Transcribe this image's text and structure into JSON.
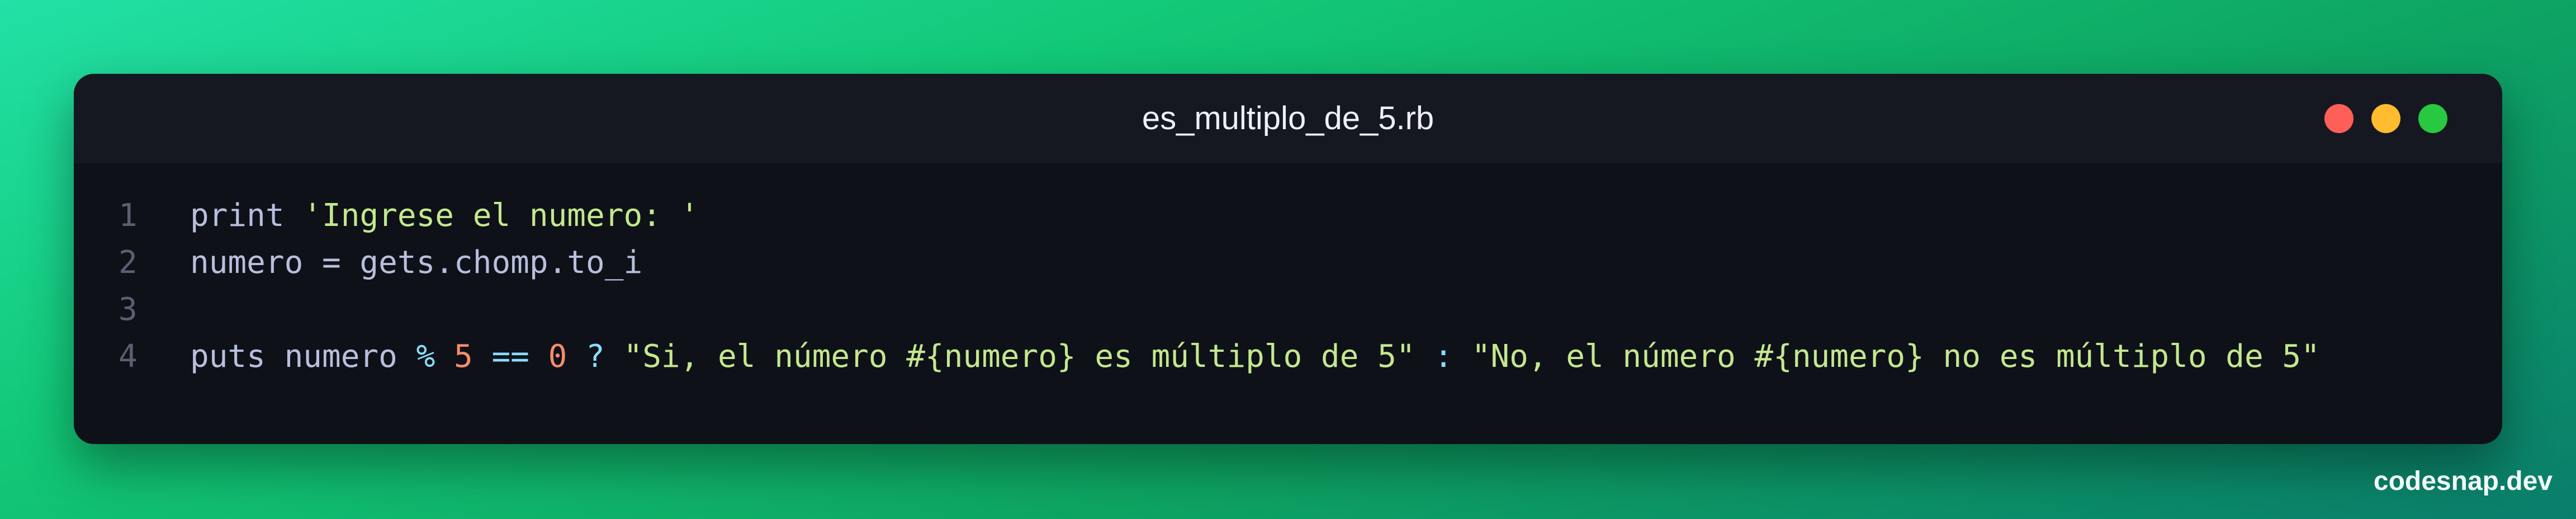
{
  "window": {
    "title": "es_multiplo_de_5.rb",
    "controls": [
      {
        "name": "close",
        "color": "#ff5f57"
      },
      {
        "name": "minimize",
        "color": "#febc2e"
      },
      {
        "name": "maximize",
        "color": "#28c840"
      }
    ]
  },
  "code": {
    "lines": [
      {
        "number": "1",
        "tokens": [
          {
            "text": "print ",
            "type": "id"
          },
          {
            "text": "'Ingrese el numero: '",
            "type": "str"
          }
        ]
      },
      {
        "number": "2",
        "tokens": [
          {
            "text": "numero = gets.chomp.to_i",
            "type": "id"
          }
        ]
      },
      {
        "number": "3",
        "tokens": []
      },
      {
        "number": "4",
        "tokens": [
          {
            "text": "puts numero ",
            "type": "id"
          },
          {
            "text": "%",
            "type": "op"
          },
          {
            "text": " ",
            "type": "id"
          },
          {
            "text": "5",
            "type": "num"
          },
          {
            "text": " ",
            "type": "id"
          },
          {
            "text": "==",
            "type": "op"
          },
          {
            "text": " ",
            "type": "id"
          },
          {
            "text": "0",
            "type": "num"
          },
          {
            "text": " ",
            "type": "id"
          },
          {
            "text": "?",
            "type": "op"
          },
          {
            "text": " ",
            "type": "id"
          },
          {
            "text": "\"Si, el número #{numero} es múltiplo de 5\"",
            "type": "str"
          },
          {
            "text": " ",
            "type": "id"
          },
          {
            "text": ":",
            "type": "op"
          },
          {
            "text": " ",
            "type": "id"
          },
          {
            "text": "\"No, el número #{numero} no es múltiplo de 5\"",
            "type": "str"
          }
        ]
      }
    ]
  },
  "watermark": "codesnap.dev"
}
